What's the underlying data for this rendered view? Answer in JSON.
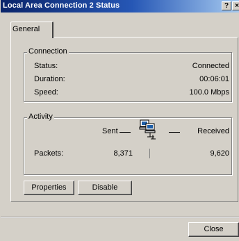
{
  "window": {
    "title": "Local Area Connection 2 Status",
    "help_glyph": "?",
    "close_glyph": "×"
  },
  "tabs": [
    {
      "label": "General"
    }
  ],
  "connection": {
    "group_label": "Connection",
    "rows": [
      {
        "label": "Status:",
        "value": "Connected"
      },
      {
        "label": "Duration:",
        "value": "00:06:01"
      },
      {
        "label": "Speed:",
        "value": "100.0 Mbps"
      }
    ]
  },
  "activity": {
    "group_label": "Activity",
    "sent_label": "Sent",
    "received_label": "Received",
    "packets_label": "Packets:",
    "packets_sent": "8,371",
    "packets_received": "9,620",
    "icon": "network-computers-icon"
  },
  "buttons": {
    "properties": "Properties",
    "disable": "Disable",
    "close": "Close"
  }
}
